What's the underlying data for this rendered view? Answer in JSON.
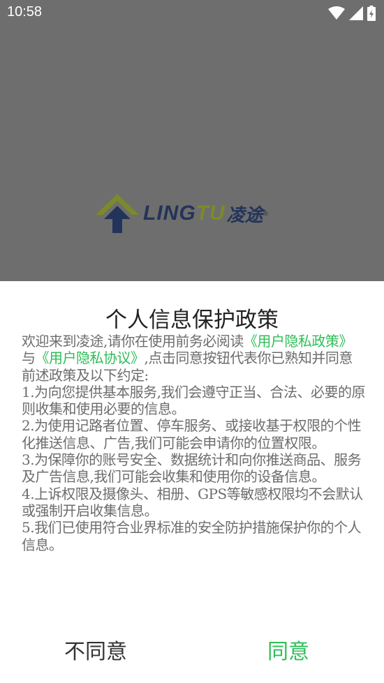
{
  "status_bar": {
    "time": "10:58",
    "icons": [
      "wifi-icon",
      "signal-icon",
      "battery-icon"
    ]
  },
  "splash": {
    "logo_text_a": "LING",
    "logo_text_b": "TU",
    "logo_cn": "凌途",
    "logo_reg": "®"
  },
  "dialog": {
    "title": "个人信息保护政策",
    "intro_a": "欢迎来到凌途,请你在使用前务必阅读",
    "link_privacy_policy": "《用户隐私政策》",
    "intro_b": "与",
    "link_privacy_agreement": "《用户隐私协议》",
    "intro_c": ",点击同意按钮代表你已熟知并同意前述政策及以下约定:",
    "items": [
      "1.为向您提供基本服务,我们会遵守正当、合法、必要的原则收集和使用必要的信息。",
      "2.为使用记路者位置、停车服务、或接收基于权限的个性化推送信息、广告,我们可能会申请你的位置权限。",
      "3.为保障你的账号安全、数据统计和向你推送商品、服务及广告信息,我们可能会收集和使用你的设备信息。",
      "4.上诉权限及摄像头、相册、GPS等敏感权限均不会默认或强制开启收集信息。",
      "5.我们已使用符合业界标准的安全防护措施保护你的个人信息。"
    ],
    "disagree_label": "不同意",
    "agree_label": "同意"
  },
  "colors": {
    "accent": "#2ebd57",
    "overlay": "#6e6e6e",
    "logo_navy": "#23345a",
    "logo_olive": "#7c8a28"
  }
}
